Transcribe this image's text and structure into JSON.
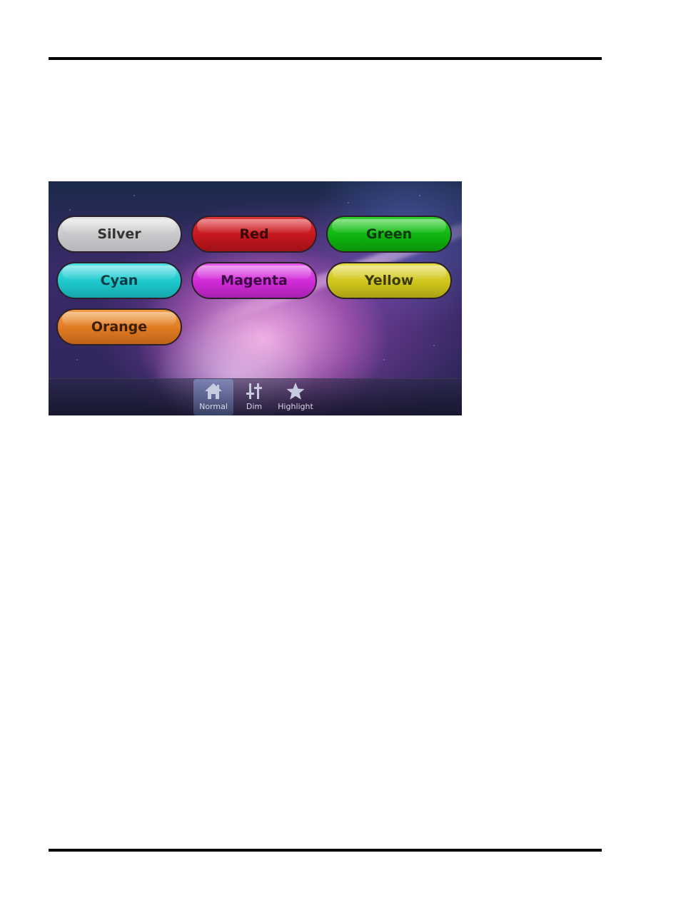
{
  "color_buttons": [
    {
      "label": "Silver"
    },
    {
      "label": "Red"
    },
    {
      "label": "Green"
    },
    {
      "label": "Cyan"
    },
    {
      "label": "Magenta"
    },
    {
      "label": "Yellow"
    },
    {
      "label": "Orange"
    }
  ],
  "navbar": {
    "items": [
      {
        "label": "Normal",
        "icon": "home-icon",
        "active": true
      },
      {
        "label": "Dim",
        "icon": "sliders-icon",
        "active": false
      },
      {
        "label": "Highlight",
        "icon": "star-icon",
        "active": false
      }
    ]
  },
  "colors": {
    "silver": "#c9c9cc",
    "red": "#c4161c",
    "green": "#10b410",
    "cyan": "#1ec8cc",
    "magenta": "#d02ad8",
    "yellow": "#cfc51c",
    "orange": "#e07a22"
  }
}
